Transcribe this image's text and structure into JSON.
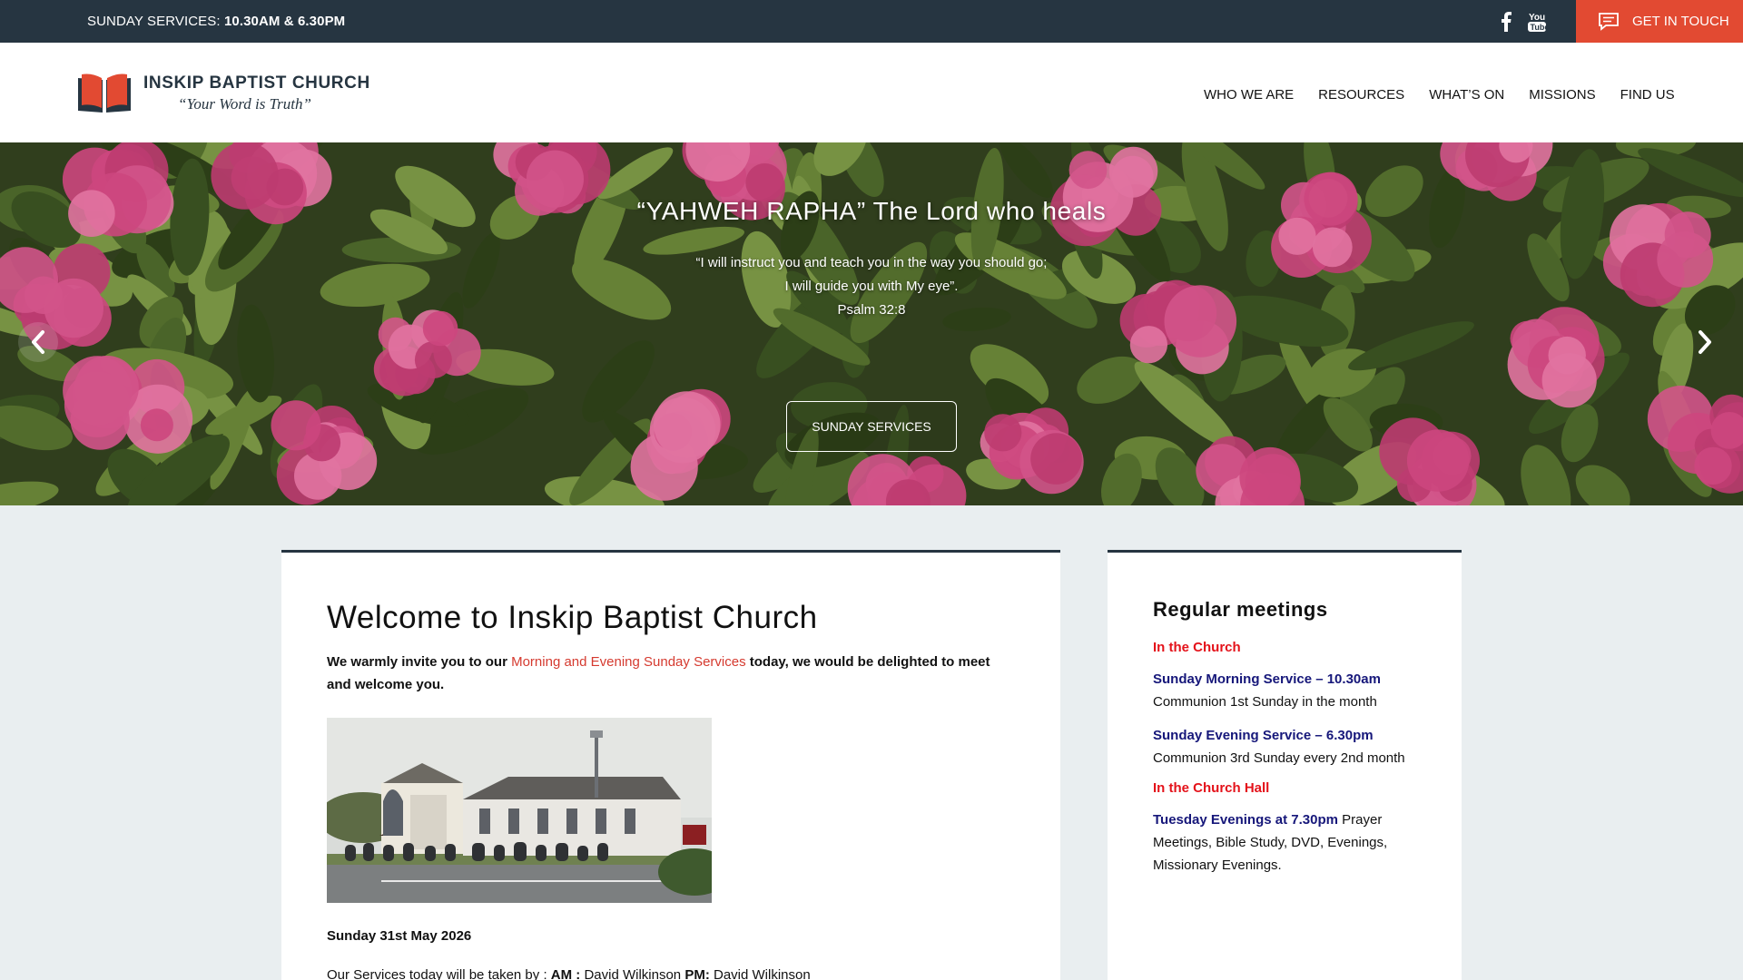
{
  "topbar": {
    "services_prefix": "SUNDAY SERVICES:",
    "services_times": "10.30AM & 6.30PM",
    "contact_label": "GET IN TOUCH",
    "social": [
      "facebook-icon",
      "youtube-icon"
    ]
  },
  "header": {
    "church_name": "INSKIP BAPTIST CHURCH",
    "motto": "“Your Word is Truth”",
    "nav": [
      "WHO WE ARE",
      "RESOURCES",
      "WHAT’S ON",
      "MISSIONS",
      "FIND US"
    ]
  },
  "hero": {
    "title": "“YAHWEH RAPHA” The Lord who heals",
    "verse_line1": "“I will instruct you and teach you in the way you should go;",
    "verse_line2": "I will guide you with My eye”.",
    "verse_ref": "Psalm 32:8",
    "button_label": "SUNDAY SERVICES"
  },
  "main": {
    "heading": "Welcome to Inskip Baptist Church",
    "intro_start": "We warmly invite you to our ",
    "intro_link": "Morning and Evening Sunday Services",
    "intro_end": " today, we would be delighted to meet and welcome you.",
    "date": "Sunday 31st May 2026",
    "taken_prefix": "Our Services today will be taken by : ",
    "am_label": "AM :",
    "am_name": " David Wilkinson ",
    "pm_label": "PM:",
    "pm_name": " David Wilkinson"
  },
  "sidebar": {
    "heading": "Regular meetings",
    "section1": "In the Church",
    "service1": "Sunday Morning Service – 10.30am",
    "desc1": "Communion 1st Sunday in the month",
    "service2": "Sunday Evening Service – 6.30pm",
    "desc2": "Communion 3rd Sunday every 2nd month",
    "section2": "In the Church Hall",
    "service3": "Tuesday Evenings at 7.30pm",
    "desc3": " Prayer Meetings, Bible Study, DVD, Evenings, Missionary Evenings."
  },
  "colors": {
    "topbar_bg": "#263541",
    "accent_red": "#e24a32",
    "link_red": "#d53a2f",
    "section_red": "#e4121a",
    "service_blue": "#16177a"
  }
}
